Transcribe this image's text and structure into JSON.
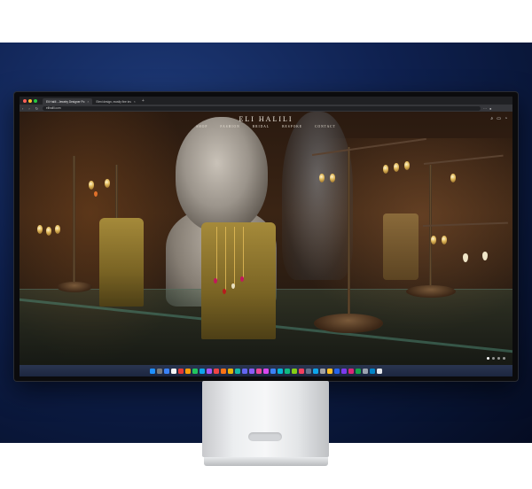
{
  "browser": {
    "tabs": [
      {
        "title": "Eli Halili - Jewelry Designer Po",
        "active": true
      },
      {
        "title": "Eleni design, mostly fine ins",
        "active": false
      }
    ],
    "url": "elihalili.com"
  },
  "site": {
    "brand": "ELI HALILI",
    "nav": [
      "SHOP",
      "FASHION",
      "BRIDAL",
      "BESPOKE",
      "CONTACT"
    ],
    "icons": [
      "search-icon",
      "bag-icon",
      "account-icon"
    ]
  },
  "colors": {
    "backdrop": "#0f2150",
    "brand_text": "#f2ece2",
    "stand_silver": "#e4e6e8"
  },
  "dock": {
    "apps": [
      "#1e90ff",
      "#7a7a7a",
      "#3b82f6",
      "#f5f5f5",
      "#e53935",
      "#f59e0b",
      "#22c55e",
      "#0ea5e9",
      "#a855f7",
      "#ef4444",
      "#f97316",
      "#eab308",
      "#14b8a6",
      "#6366f1",
      "#8b5cf6",
      "#ec4899",
      "#d946ef",
      "#3b82f6",
      "#06b6d4",
      "#10b981",
      "#84cc16",
      "#f43f5e",
      "#64748b",
      "#0ea5e9",
      "#a3a3a3",
      "#fbbf24",
      "#2563eb",
      "#7c3aed",
      "#db2777",
      "#16a34a",
      "#9ca3af",
      "#0284c7",
      "#e5e7eb"
    ]
  }
}
